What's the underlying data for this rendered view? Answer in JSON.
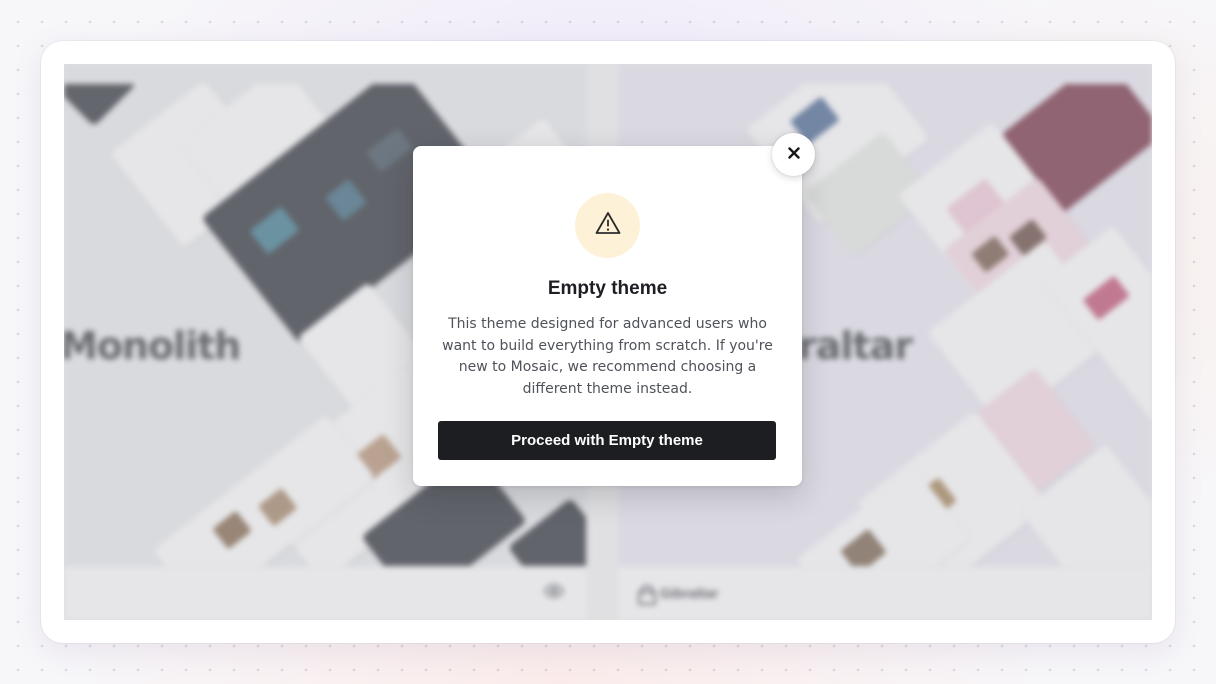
{
  "themes": {
    "left": {
      "hero_word": "Monolith",
      "footer_action_icon": "eye-icon"
    },
    "right": {
      "hero_word": "raltar",
      "footer_label": "Gibraltar",
      "footer_icon": "lock-icon"
    }
  },
  "modal": {
    "warning_icon": "warning-triangle-icon",
    "accent_color": "#b07a17",
    "title": "Empty theme",
    "body": "This theme designed for advanced users who want to build everything from scratch. If you're new to Mosaic, we recommend choosing a different theme instead.",
    "primary_button": "Proceed with Empty theme",
    "close_icon": "close-icon"
  }
}
